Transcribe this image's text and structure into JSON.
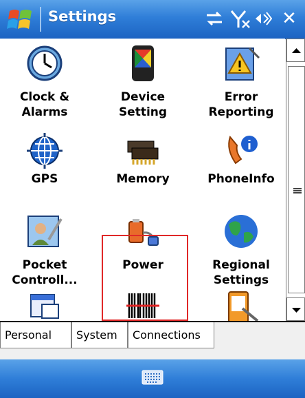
{
  "window": {
    "title": "Settings",
    "close_label": "✕"
  },
  "status_icons": [
    "connectivity-icon",
    "signal-off-icon",
    "volume-icon"
  ],
  "items": [
    {
      "label": "Clock &\nAlarms",
      "icon": "clock-icon"
    },
    {
      "label": "Device\nSetting",
      "icon": "device-setting-icon"
    },
    {
      "label": "Error\nReporting",
      "icon": "error-reporting-icon"
    },
    {
      "label": "GPS",
      "icon": "gps-icon"
    },
    {
      "label": "Memory",
      "icon": "memory-icon"
    },
    {
      "label": "PhoneInfo",
      "icon": "phone-info-icon"
    },
    {
      "label": "Pocket\nControll...",
      "icon": "pocket-controller-icon"
    },
    {
      "label": "Power",
      "icon": "power-icon"
    },
    {
      "label": "Regional\nSettings",
      "icon": "regional-settings-icon"
    },
    {
      "label": "",
      "icon": "calendar-settings-icon"
    },
    {
      "label": "",
      "icon": "barcode-icon"
    },
    {
      "label": "",
      "icon": "pda-stylus-icon"
    }
  ],
  "highlighted_item": "Power",
  "tabs": [
    {
      "label": "Personal",
      "active": false
    },
    {
      "label": "System",
      "active": true
    },
    {
      "label": "Connections",
      "active": false
    }
  ],
  "menubar": {
    "icon": "keyboard-icon"
  },
  "colors": {
    "titlebar": "#2f7ed8",
    "highlight": "#e02828"
  }
}
